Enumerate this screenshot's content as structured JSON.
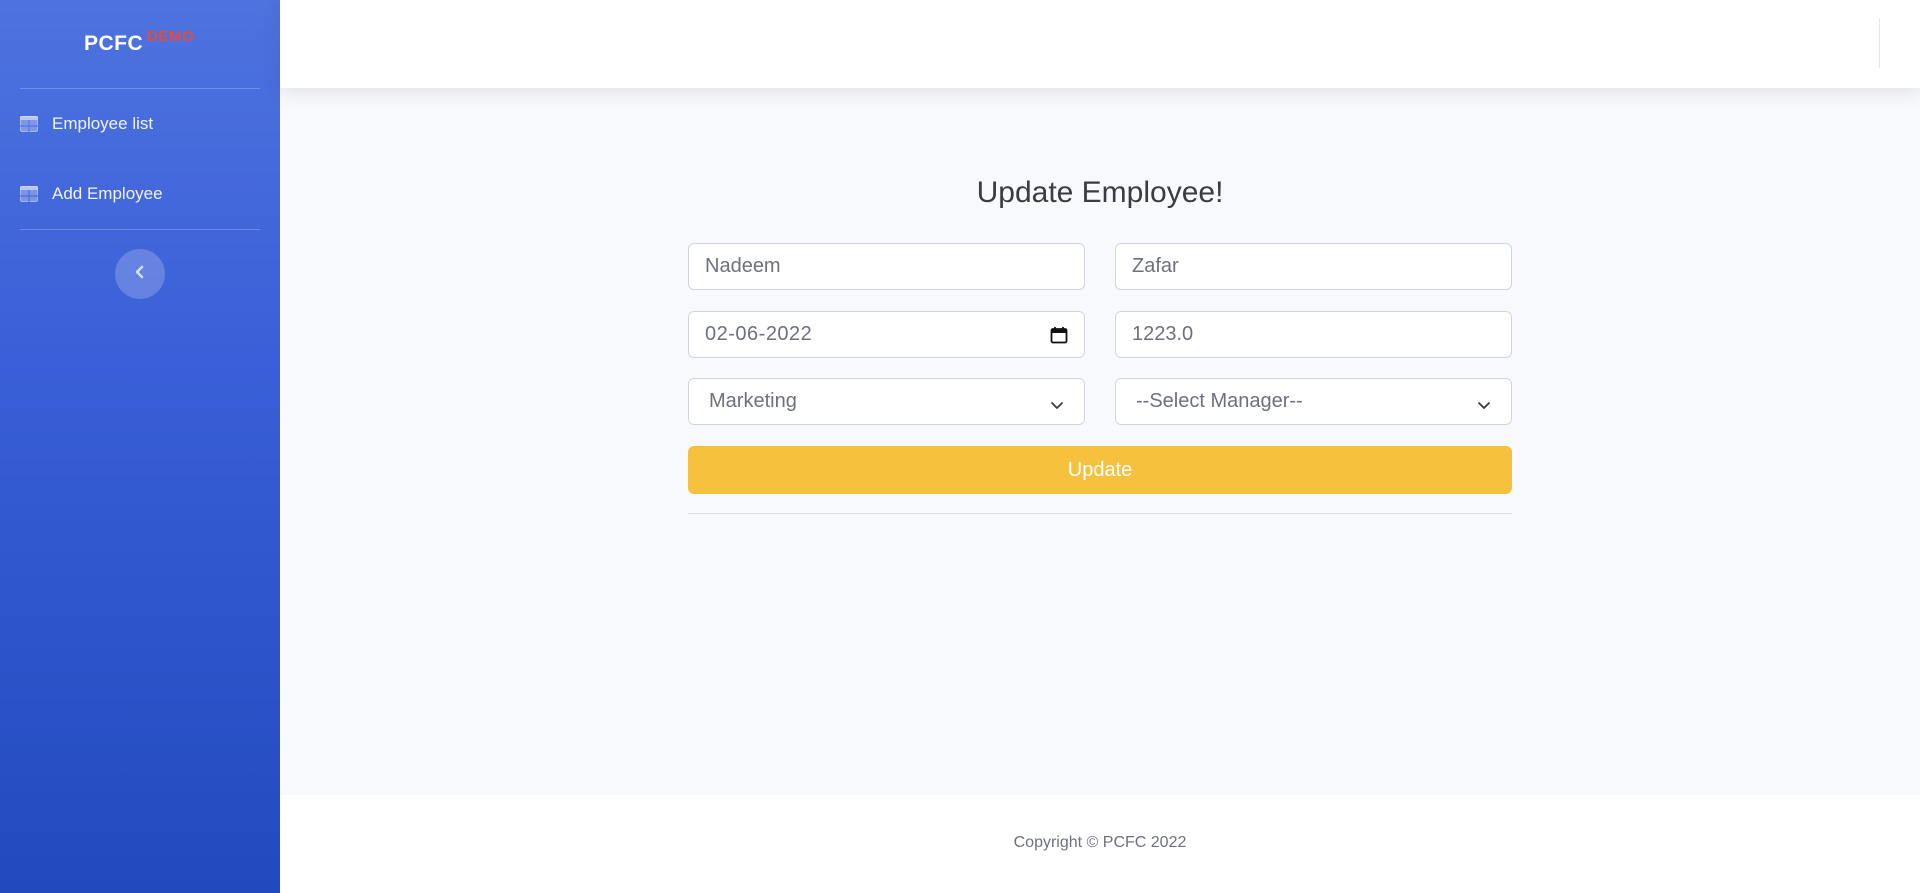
{
  "brand": {
    "name": "PCFC",
    "superscript": "DEMO"
  },
  "sidebar": {
    "items": [
      {
        "label": "Employee list",
        "icon": "table-icon"
      },
      {
        "label": "Add Employee",
        "icon": "table-icon"
      }
    ],
    "toggle_icon": "chevron-left-icon"
  },
  "form": {
    "title": "Update Employee!",
    "first_name": "Nadeem",
    "last_name": "Zafar",
    "date": "02-06-2022",
    "salary": "1223.0",
    "department": "Marketing",
    "manager": "--Select Manager--",
    "submit_label": "Update"
  },
  "footer": {
    "text": "Copyright © PCFC 2022"
  },
  "colors": {
    "sidebar_start": "#4e73df",
    "sidebar_end": "#224abe",
    "accent_warning": "#f6c23e",
    "brand_sup": "#e74a3b"
  }
}
